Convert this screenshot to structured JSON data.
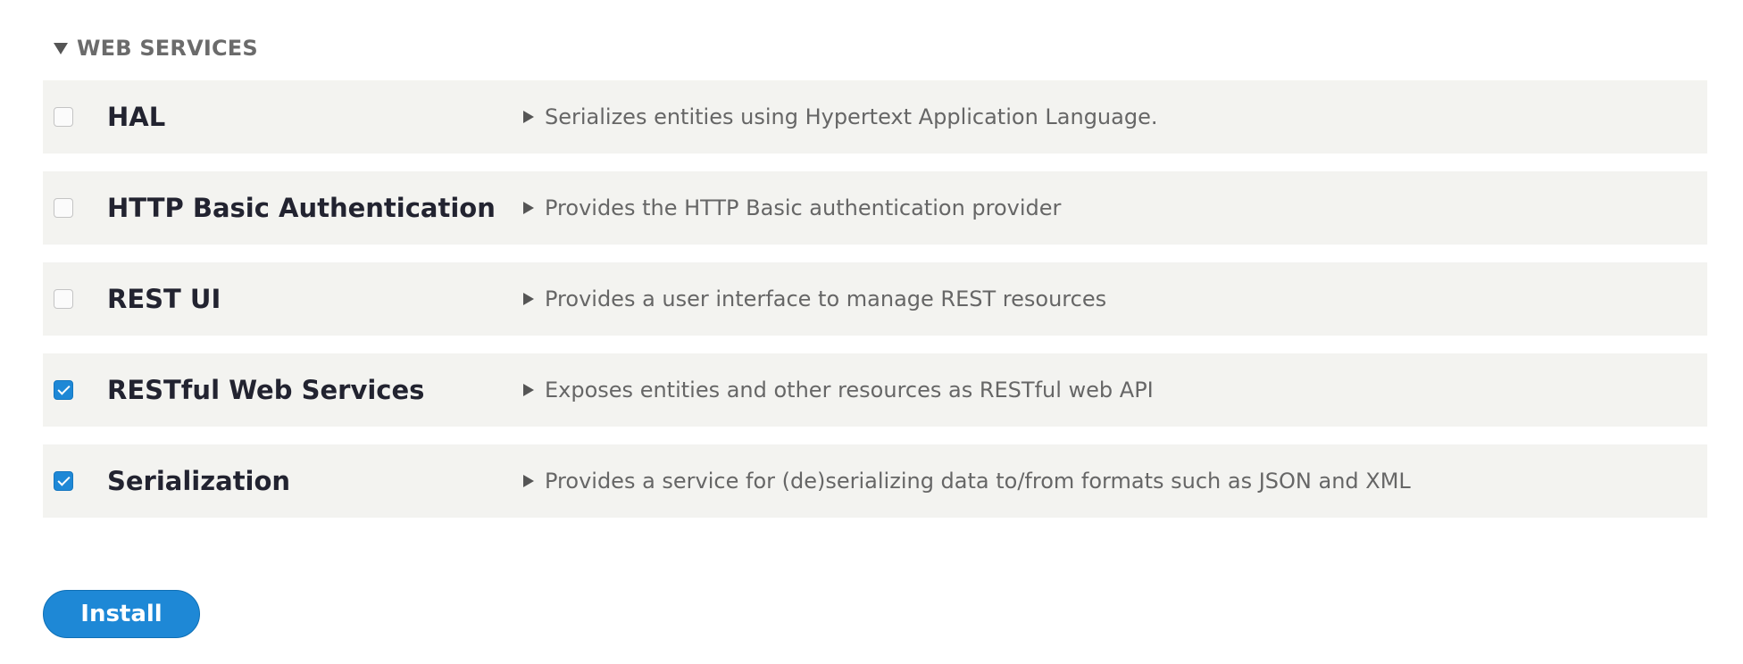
{
  "section": {
    "title": "WEB SERVICES",
    "expanded": true
  },
  "modules": [
    {
      "name": "HAL",
      "description": "Serializes entities using Hypertext Application Language.",
      "checked": false
    },
    {
      "name": "HTTP Basic Authentication",
      "description": "Provides the HTTP Basic authentication provider",
      "checked": false
    },
    {
      "name": "REST UI",
      "description": "Provides a user interface to manage REST resources",
      "checked": false
    },
    {
      "name": "RESTful Web Services",
      "description": "Exposes entities and other resources as RESTful web API",
      "checked": true
    },
    {
      "name": "Serialization",
      "description": "Provides a service for (de)serializing data to/from formats such as JSON and XML",
      "checked": true
    }
  ],
  "actions": {
    "install_label": "Install"
  },
  "colors": {
    "accent": "#1e88d6",
    "row_background": "#f3f3f0"
  }
}
